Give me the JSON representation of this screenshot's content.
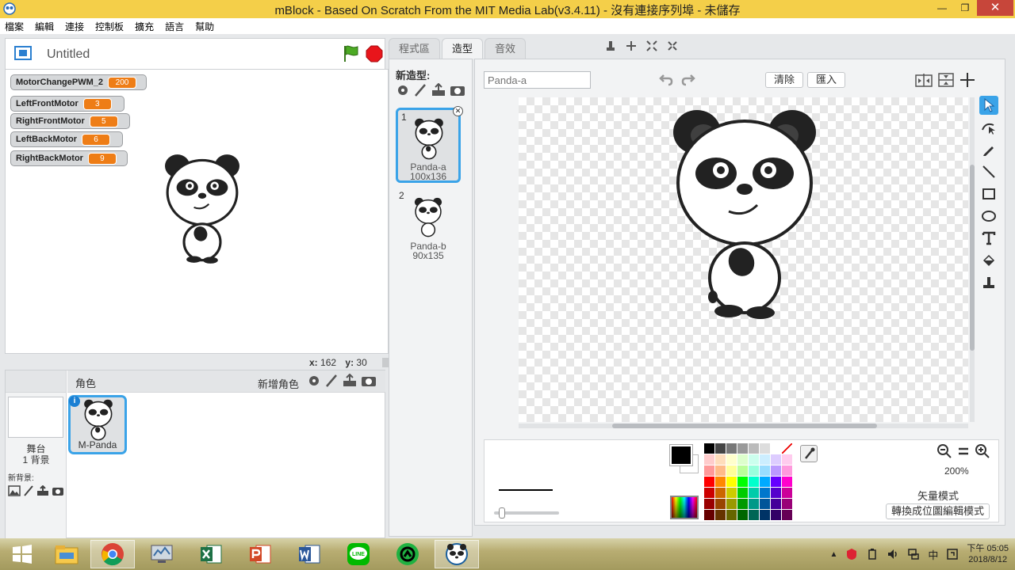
{
  "window": {
    "title": "mBlock - Based On Scratch From the MIT Media Lab(v3.4.11) - 沒有連接序列埠 - 未儲存",
    "minimize": "—",
    "restore": "❐",
    "close": "✕"
  },
  "menu": [
    "檔案",
    "編輯",
    "連接",
    "控制板",
    "擴充",
    "語言",
    "幫助"
  ],
  "stage": {
    "project_title": "Untitled",
    "monitors": [
      {
        "name": "MotorChangePWM_2",
        "value": "200"
      },
      {
        "name": "LeftFrontMotor",
        "value": "3"
      },
      {
        "name": "RightFrontMotor",
        "value": "5"
      },
      {
        "name": "LeftBackMotor",
        "value": "6"
      },
      {
        "name": "RightBackMotor",
        "value": "9"
      }
    ],
    "coords": {
      "x_label": "x:",
      "x": "162",
      "y_label": "y:",
      "y": "30"
    }
  },
  "sprites": {
    "header": "角色",
    "add_label": "新增角色",
    "stage_name": "舞台",
    "stage_backdrops": "1 背景",
    "new_backdrop_label": "新背景:",
    "items": [
      {
        "name": "M-Panda",
        "info": "i"
      }
    ]
  },
  "tabs": [
    {
      "label": "程式區",
      "active": false
    },
    {
      "label": "造型",
      "active": true
    },
    {
      "label": "音效",
      "active": false
    }
  ],
  "costumes": {
    "new_label": "新造型:",
    "items": [
      {
        "index": "1",
        "name": "Panda-a",
        "size": "100x136",
        "selected": true
      },
      {
        "index": "2",
        "name": "Panda-b",
        "size": "90x135",
        "selected": false
      }
    ]
  },
  "editor": {
    "costume_name": "Panda-a",
    "clear_label": "清除",
    "import_label": "匯入",
    "zoom_percent": "200%",
    "mode_label": "矢量模式",
    "convert_label": "轉換成位圖編輯模式",
    "palette_colors": [
      "#000000",
      "#444444",
      "#777777",
      "#999999",
      "#bbbbbb",
      "#dddddd",
      "#ffffff",
      "none",
      "#ffcccc",
      "#ffddbb",
      "#ffffcc",
      "#ddffcc",
      "#ccffee",
      "#cceeff",
      "#ddccff",
      "#ffccee",
      "#ff9999",
      "#ffbb88",
      "#ffff99",
      "#bbff99",
      "#99ffdd",
      "#99ddff",
      "#bb99ff",
      "#ff99dd",
      "#ff0000",
      "#ff8800",
      "#ffff00",
      "#00ff00",
      "#00ffcc",
      "#00aaff",
      "#6600ff",
      "#ff00cc",
      "#cc0000",
      "#cc6600",
      "#cccc00",
      "#00cc00",
      "#00ccaa",
      "#0077cc",
      "#5500cc",
      "#cc0099",
      "#990000",
      "#994400",
      "#999900",
      "#009900",
      "#009988",
      "#005599",
      "#440099",
      "#990077",
      "#660000",
      "#663300",
      "#666600",
      "#006600",
      "#006655",
      "#003366",
      "#330066",
      "#660055"
    ],
    "primary_color": "#000000"
  },
  "taskbar": {
    "clock_time": "下午 05:05",
    "clock_date": "2018/8/12",
    "ime": "中"
  }
}
